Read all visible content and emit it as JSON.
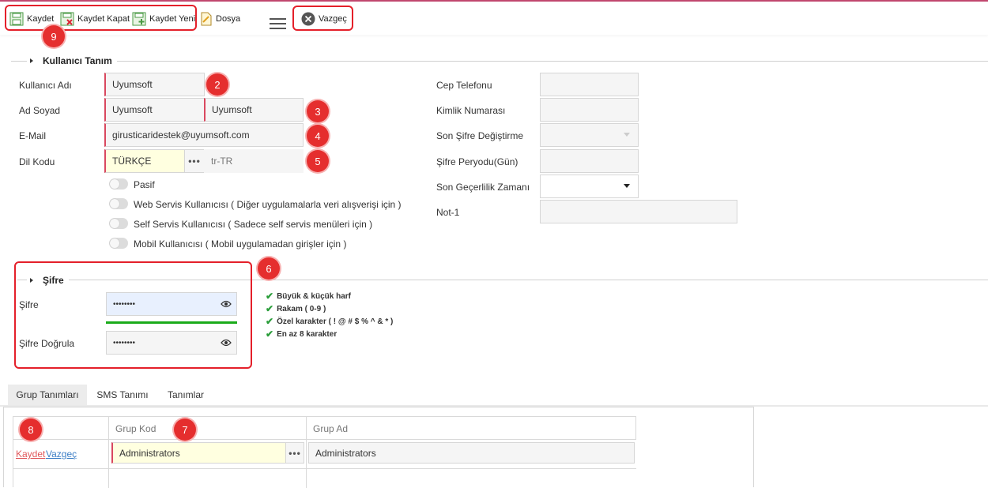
{
  "toolbar": {
    "save_label": "Kaydet",
    "save_close_label": "Kaydet Kapat",
    "save_new_label": "Kaydet Yeni",
    "file_label": "Dosya",
    "cancel_label": "Vazgeç"
  },
  "badges": {
    "b1": "9",
    "b2": "2",
    "b3": "3",
    "b4": "4",
    "b5": "5",
    "b6": "6",
    "b7": "7",
    "b8": "8"
  },
  "user_section": {
    "title": "Kullanıcı Tanım",
    "username_label": "Kullanıcı Adı",
    "username_value": "Uyumsoft",
    "fullname_label": "Ad Soyad",
    "first_name_value": "Uyumsoft",
    "last_name_value": "Uyumsoft",
    "email_label": "E-Mail",
    "email_value": "girusticaridestek@uyumsoft.com",
    "lang_label": "Dil Kodu",
    "lang_value": "TÜRKÇE",
    "lang_code": "tr-TR",
    "toggles": [
      "Pasif",
      "Web Servis Kullanıcısı ( Diğer uygulamalarla veri alışverişi için )",
      "Self Servis Kullanıcısı ( Sadece self servis menüleri için )",
      "Mobil Kullanıcısı ( Mobil uygulamadan girişler için )"
    ],
    "right_labels": [
      "Cep Telefonu",
      "Kimlik Numarası",
      "Son Şifre Değiştirme",
      "Şifre Peryodu(Gün)",
      "Son Geçerlilik Zamanı",
      "Not-1"
    ]
  },
  "password_section": {
    "title": "Şifre",
    "password_label": "Şifre",
    "password_value": "••••••••",
    "confirm_label": "Şifre Doğrula",
    "confirm_value": "••••••••",
    "strength_percent": 100,
    "rules": [
      "Büyük & küçük harf",
      "Rakam ( 0-9 )",
      "Özel karakter ( ! @ # $ % ^ & * )",
      "En az 8 karakter"
    ]
  },
  "tabs": [
    "Grup Tanımları",
    "SMS Tanımı",
    "Tanımlar"
  ],
  "grid": {
    "headers": [
      "Grup Kod",
      "Grup Ad"
    ],
    "row_save": "Kaydet",
    "row_cancel": "Vazgeç",
    "grup_kod": "Administrators",
    "grup_ad": "Administrators"
  },
  "colors": {
    "accent": "#c0466e",
    "highlight": "#e4202a",
    "strength": "#1aab1a",
    "required": "#d9485f"
  }
}
